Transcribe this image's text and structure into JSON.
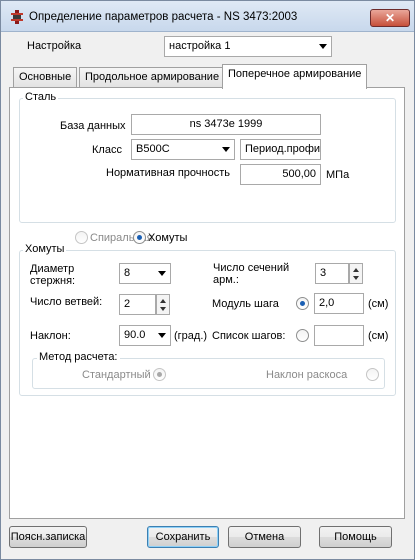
{
  "window": {
    "title": "Определение параметров расчета - NS 3473:2003",
    "close_glyph": "✕"
  },
  "settings": {
    "label": "Настройка",
    "value": "настройка 1"
  },
  "tabs": [
    {
      "label": "Основные"
    },
    {
      "label": "Продольное армирование"
    },
    {
      "label": "Поперечное армирование"
    }
  ],
  "steel": {
    "group_title": "Сталь",
    "database_label": "База данных",
    "database_value": "ns 3473e 1999",
    "class_label": "Класс",
    "class_value": "B500C",
    "profile_value": "Период.профиль",
    "strength_label": "Нормативная прочность",
    "strength_value": "500,00",
    "strength_unit": "МПа"
  },
  "reinforcement_type": {
    "spiral_label": "Спиральная",
    "stirrups_label": "Хомуты"
  },
  "stirrups": {
    "group_title": "Хомуты",
    "diameter_label": "Диаметр стержня:",
    "diameter_value": "8",
    "sections_label": "Число сечений арм.:",
    "sections_value": "3",
    "branches_label": "Число ветвей:",
    "branches_value": "2",
    "step_module_label": "Модуль шага",
    "step_module_value": "2,0",
    "step_unit": "(см)",
    "slope_label": "Наклон:",
    "slope_value": "90.0",
    "slope_unit": "(град.)",
    "step_list_label": "Список шагов:",
    "step_list_value": "",
    "step_list_unit": "(см)",
    "method_title": "Метод расчета:",
    "standard_label": "Стандартный",
    "strut_label": "Наклон раскоса"
  },
  "buttons": {
    "notes": "Поясн.записка",
    "save": "Сохранить",
    "cancel": "Отмена",
    "help": "Помощь"
  }
}
